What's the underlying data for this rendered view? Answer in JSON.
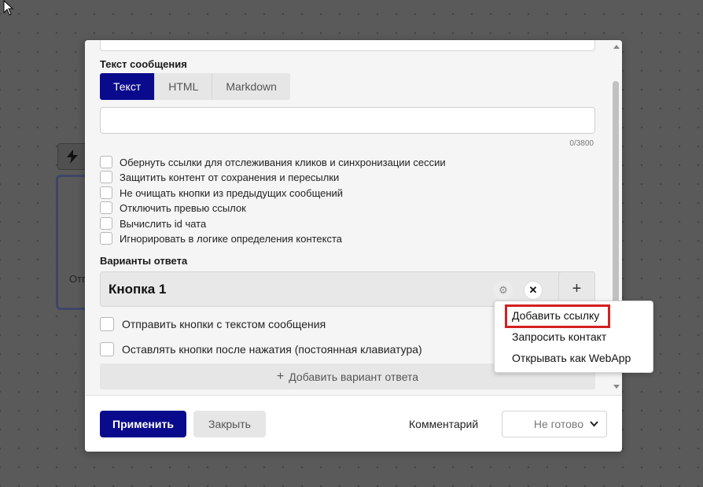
{
  "canvas": {
    "node_text": "Отп"
  },
  "message_section": {
    "label": "Текст сообщения",
    "tabs": [
      {
        "label": "Текст",
        "active": true
      },
      {
        "label": "HTML",
        "active": false
      },
      {
        "label": "Markdown",
        "active": false
      }
    ],
    "text_value": "",
    "char_counter": "0/3800"
  },
  "options": [
    {
      "label": "Обернуть ссылки для отслеживания кликов и синхронизации сессии",
      "checked": false
    },
    {
      "label": "Защитить контент от сохранения и пересылки",
      "checked": false
    },
    {
      "label": "Не очищать кнопки из предыдущих сообщений",
      "checked": false
    },
    {
      "label": "Отключить превью ссылок",
      "checked": false
    },
    {
      "label": "Вычислить id чата",
      "checked": false
    },
    {
      "label": "Игнорировать в логике определения контекста",
      "checked": false
    }
  ],
  "answers": {
    "label": "Варианты ответа",
    "button_title": "Кнопка 1",
    "send_with_text": {
      "label": "Отправить кнопки с текстом сообщения",
      "checked": false
    },
    "persistent": {
      "label": "Оставлять кнопки после нажатия (постоянная клавиатура)",
      "checked": false
    },
    "add_variant_label": "Добавить вариант ответа"
  },
  "dropdown_menu": {
    "items": [
      "Добавить ссылку",
      "Запросить контакт",
      "Открывать как WebApp"
    ],
    "highlighted_index": 0
  },
  "footer": {
    "apply_label": "Применить",
    "close_label": "Закрыть",
    "comment_label": "Комментарий",
    "status_value": "Не готово"
  },
  "colors": {
    "primary": "#0a0a8c",
    "highlight": "#d32020"
  }
}
